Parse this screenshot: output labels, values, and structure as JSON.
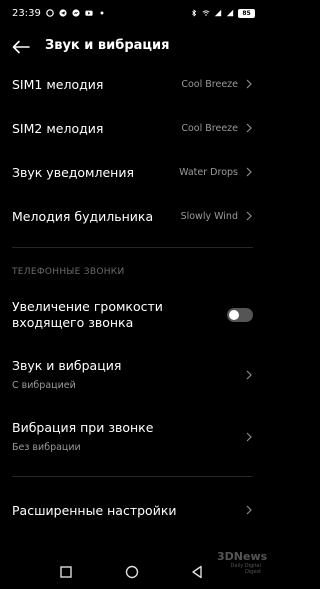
{
  "status_bar": {
    "time": "23:39",
    "battery": "85"
  },
  "header": {
    "title": "Звук и вибрация"
  },
  "rows": [
    {
      "label": "SIM1 мелодия",
      "value": "Cool Breeze"
    },
    {
      "label": "SIM2 мелодия",
      "value": "Cool Breeze"
    },
    {
      "label": "Звук уведомления",
      "value": "Water Drops"
    },
    {
      "label": "Мелодия будильника",
      "value": "Slowly Wind"
    }
  ],
  "calls_section": {
    "header": "ТЕЛЕФОННЫЕ ЗВОНКИ",
    "volume_increase": {
      "label_line1": "Увеличение громкости",
      "label_line2": "входящего звонка",
      "enabled": false
    },
    "sound_vibration": {
      "label": "Звук и вибрация",
      "sub": "С вибрацией"
    },
    "ring_vibration": {
      "label": "Вибрация при звонке",
      "sub": "Без вибрации"
    }
  },
  "advanced": {
    "label": "Расширенные настройки"
  },
  "watermark": {
    "brand": "3DNews",
    "tagline": "Daily Digital Digest"
  },
  "colors": {
    "background": "#000000",
    "text": "#ffffff",
    "secondary": "#9a9a9a",
    "toggle_off": "#555555"
  }
}
